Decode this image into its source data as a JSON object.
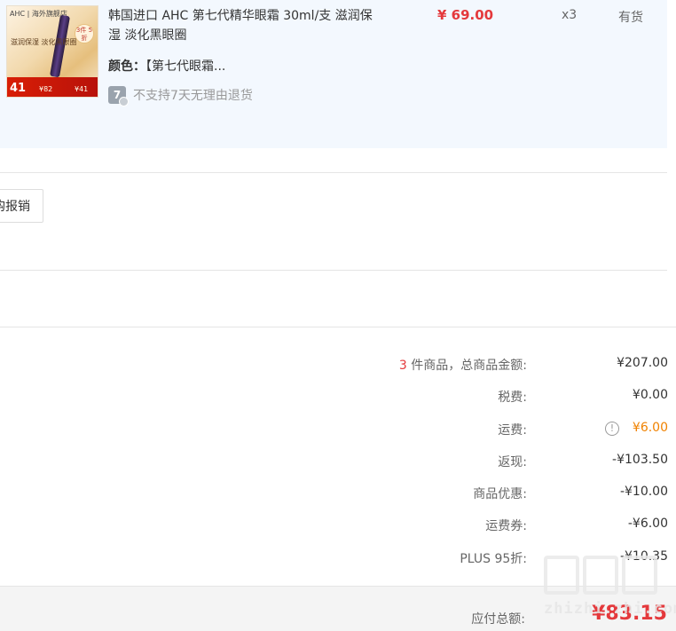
{
  "product": {
    "image_lettering": {
      "brand": "AHC | 海外旗舰店",
      "discount": "3件 5折",
      "slogan": "滋润保湿 淡化黑眼圈",
      "price_big": "41",
      "price_a": "¥82",
      "price_b": "¥41"
    },
    "title": "韩国进口 AHC 第七代精华眼霜 30ml/支 滋润保湿 淡化黑眼圈",
    "price": "¥ 69.00",
    "quantity": "x3",
    "stock": "有货",
    "attr_label": "颜色：",
    "attr_value": "【第七代眼霜...",
    "return_icon": "7",
    "return_note": "不支持7天无理由退货"
  },
  "reimburse_button": "购报销",
  "summary": {
    "items_count": "3",
    "items_label_suffix": " 件商品，总商品金额:",
    "items_total": "¥207.00",
    "tax_label": "税费:",
    "tax_value": "¥0.00",
    "shipping_label": "运费:",
    "shipping_value": "¥6.00",
    "cashback_label": "返现:",
    "cashback_value": "-¥103.50",
    "discount_label": "商品优惠:",
    "discount_value": "-¥10.00",
    "shipping_coupon_label": "运费券:",
    "shipping_coupon_value": "-¥6.00",
    "plus_label": "PLUS 95折:",
    "plus_value": "-¥10.35"
  },
  "total": {
    "label": "应付总额:",
    "value": "¥83.15"
  },
  "watermark": {
    "site": "zhizhi.zhi.com"
  },
  "colors": {
    "accent_red": "#e4393c",
    "shipping_orange": "#f08200",
    "product_bg": "#f3f8fe"
  }
}
